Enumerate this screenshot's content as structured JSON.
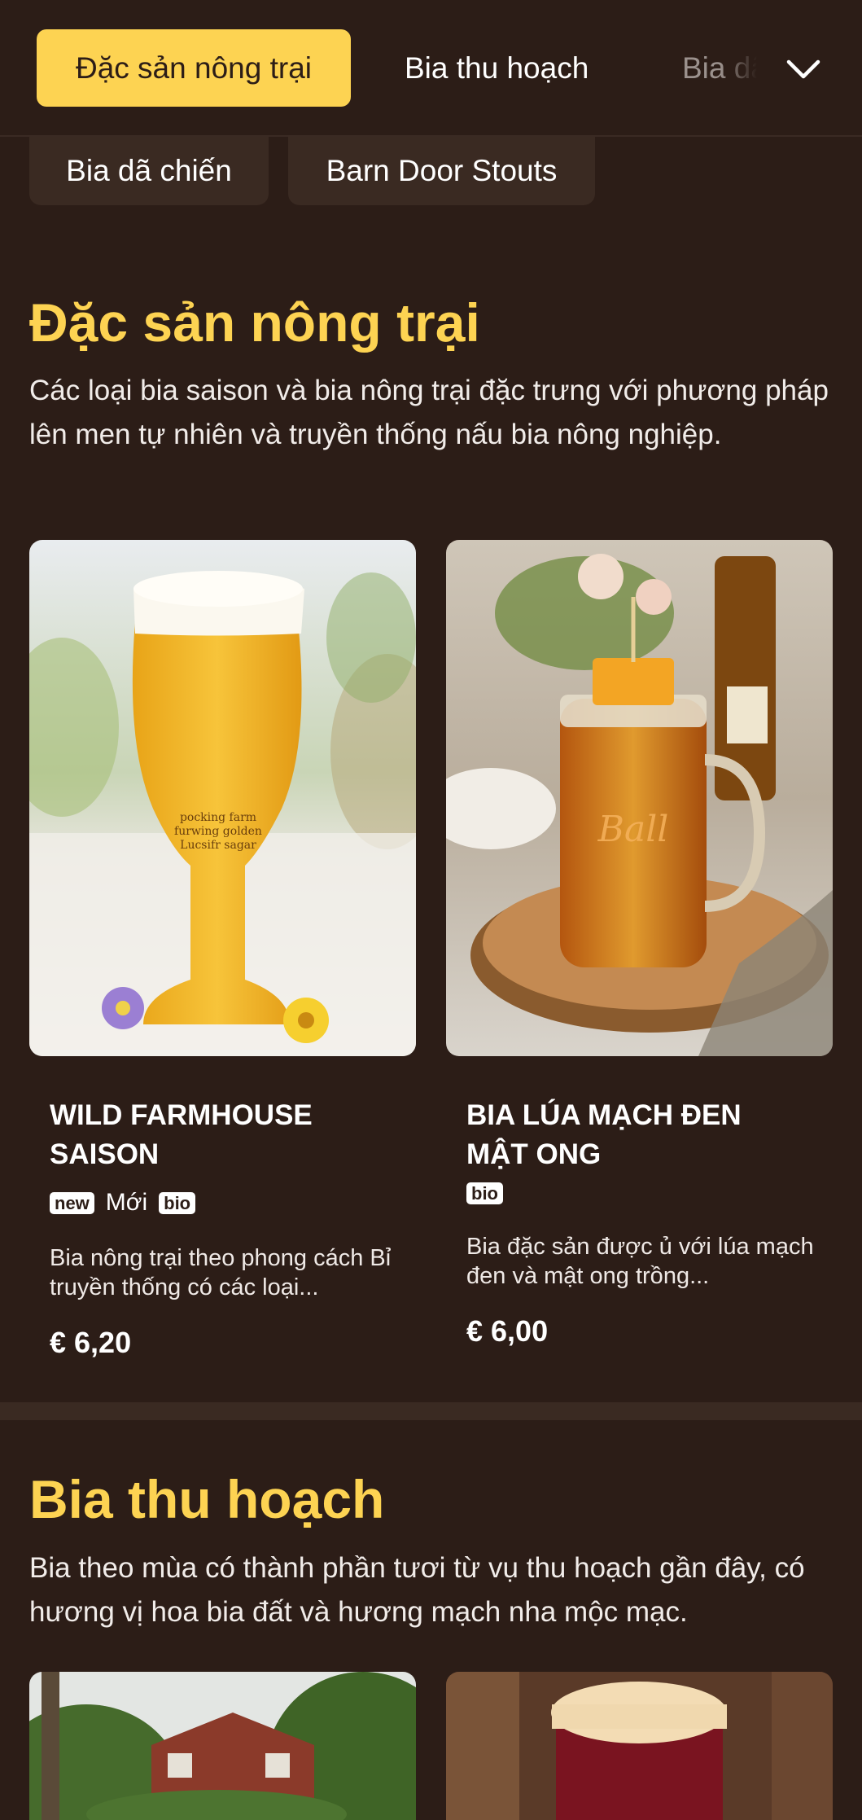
{
  "tabs": {
    "active": "Đặc sản nông trại",
    "second": "Bia thu hoạch",
    "third": "Bia dã chiến"
  },
  "chips": [
    "Bia dã chiến",
    "Barn Door Stouts"
  ],
  "sections": [
    {
      "title": "Đặc sản nông trại",
      "description": "Các loại bia saison và bia nông trại đặc trưng với phương pháp lên men tự nhiên và truyền thống nấu bia nông nghiệp.",
      "products": [
        {
          "name": "WILD FARMHOUSE SAISON",
          "badges": [
            "new",
            "bio"
          ],
          "badge_label": "Mới",
          "description": "Bia nông trại theo phong cách Bỉ truyền thống có các loại...",
          "price": "€ 6,20",
          "glass_text": [
            "pocking farm",
            "furwing golden",
            "Lucsifr sagar"
          ]
        },
        {
          "name": "BIA LÚA MẠCH ĐEN MẬT ONG",
          "badges": [
            "bio"
          ],
          "description": "Bia đặc sản được ủ với lúa mạch đen và mật ong trồng...",
          "price": "€ 6,00",
          "jar_text": "Ball"
        }
      ]
    },
    {
      "title": "Bia thu hoạch",
      "description": "Bia theo mùa có thành phần tươi từ vụ thu hoạch gần đây, có hương vị hoa bia đất và hương mạch nha mộc mạc."
    }
  ],
  "colors": {
    "background": "#2c1d17",
    "accent": "#fdd352",
    "chip": "#3a2a22"
  }
}
